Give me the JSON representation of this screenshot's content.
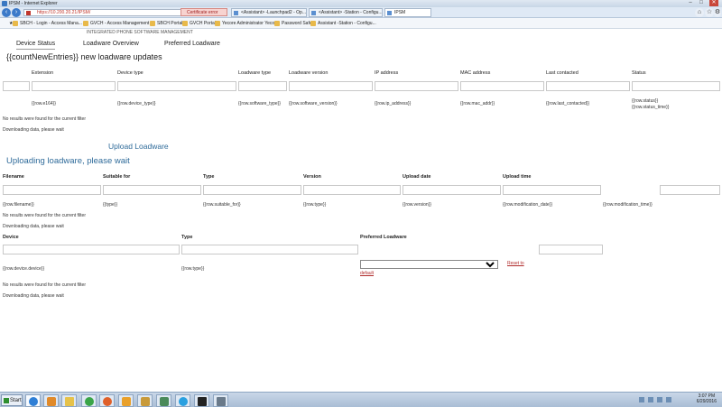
{
  "window": {
    "title": "IPSM - Internet Explorer",
    "controls": {
      "minimize": "–",
      "maximize": "□",
      "close": "✕"
    }
  },
  "browser": {
    "url": "https://10.200.20.21/IPSM/",
    "cert_error": "Certificate error",
    "tabs": [
      {
        "label": "<Assistant> -Launchpad2 - Op..."
      },
      {
        "label": "<Assistant> -Station - Configu..."
      },
      {
        "label": "IPSM"
      }
    ]
  },
  "favorites": [
    {
      "label": "SBCH - Login - Access Mana..."
    },
    {
      "label": "GVCH - Access Management"
    },
    {
      "label": "SBCH Portal"
    },
    {
      "label": "GVCH Portal"
    },
    {
      "label": "Yecore Administrator Yecor..."
    },
    {
      "label": "Password Safe"
    },
    {
      "label": "Assistant -Station - Configu..."
    }
  ],
  "app": {
    "header": "INTEGRATED PHONE SOFTWARE MANAGEMENT",
    "nav": [
      "Device Status",
      "Loadware Overview",
      "Preferred Loadware"
    ],
    "updates_title": "{{countNewEntries}} new loadware updates",
    "device_table": {
      "columns": [
        "Extension",
        "Device type",
        "Loadware type",
        "Loadware version",
        "IP address",
        "MAC address",
        "Last contacted",
        "Status"
      ],
      "row": [
        "{{row.e164}}",
        "{{row.device_type}}",
        "{{row.software_type}}",
        "{{row.software_version}}",
        "{{row.ip_address}}",
        "{{row.mac_addr}}",
        "{{row.last_contacted}}",
        "{{row.status}}"
      ],
      "status_time": "{{row.status_time}}",
      "no_results": "No results were found for the current filter",
      "loading": "Downloading data, please wait"
    },
    "upload_title": "Upload Loadware",
    "uploading_title": "Uploading loadware, please wait",
    "loadware_table": {
      "columns": [
        "Filename",
        "Suitable for",
        "Type",
        "Version",
        "Upload date",
        "Upload time"
      ],
      "row": [
        "{{row.filename}}",
        "{{type}}",
        "{{row.suitable_for}}",
        "{{row.type}}",
        "{{row.version}}",
        "{{row.modification_date}}",
        "{{row.modification_time}}"
      ],
      "no_results": "No results were found for the current filter",
      "loading": "Downloading data, please wait"
    },
    "preferred_table": {
      "columns": [
        "Device",
        "Type",
        "Preferred Loadware"
      ],
      "row": [
        "{{row.device.device}}",
        "{{row.type}}"
      ],
      "reset_link_1": "Reset to",
      "reset_link_2": "default",
      "no_results": "No results were found for the current filter",
      "loading": "Downloading data, please wait"
    }
  },
  "taskbar": {
    "start": "Start",
    "clock_time": "3:07 PM",
    "clock_date": "6/29/2016"
  },
  "colors": {
    "accent_blue": "#2f6b9a",
    "link_red": "#b02a2a",
    "taskbar": "#b5c8de"
  }
}
